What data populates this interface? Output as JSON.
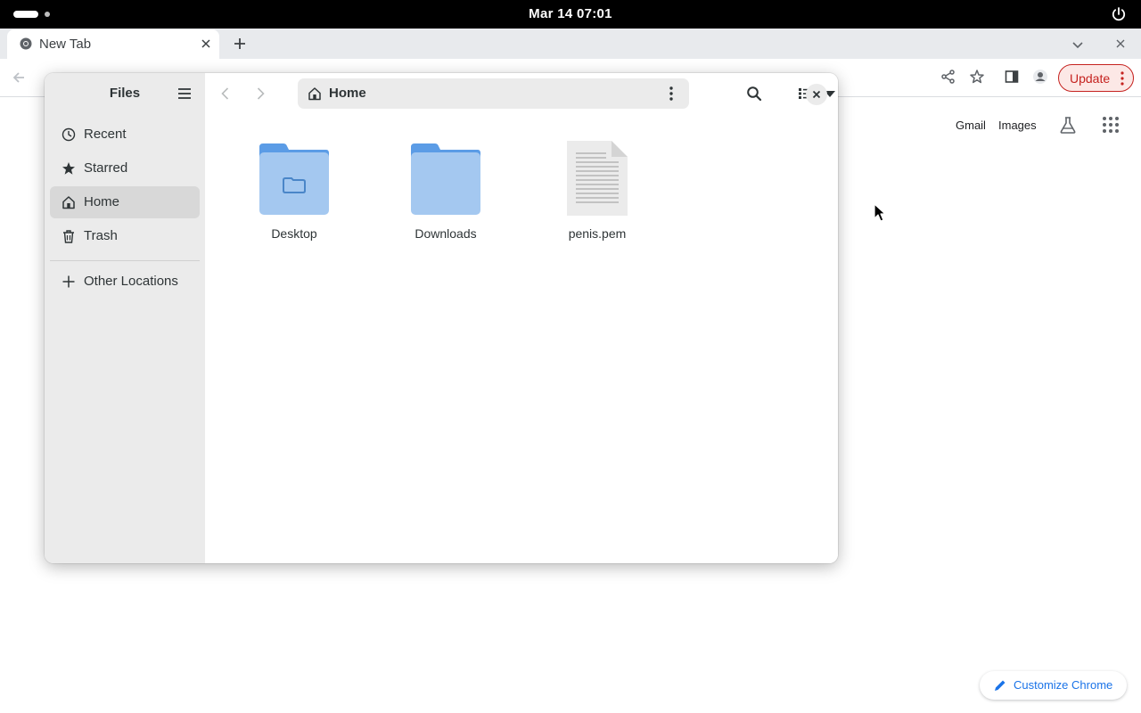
{
  "topbar": {
    "clock": "Mar 14  07:01",
    "activities_icon": "activities-pill-icon",
    "power_icon": "power-icon"
  },
  "chrome": {
    "tab": {
      "title": "New Tab",
      "favicon": "chrome-icon",
      "close_icon": "close-icon"
    },
    "new_tab_icon": "plus-icon",
    "tab_search_icon": "chevron-down-icon",
    "window_close_icon": "close-icon",
    "toolbar_icons": [
      "back-arrow-icon",
      "share-icon",
      "star-icon",
      "side-panel-icon",
      "profile-icon",
      "kebab-menu-icon"
    ],
    "update_label": "Update",
    "accent": "#c5221f"
  },
  "ntp": {
    "gmail": "Gmail",
    "images": "Images",
    "labs_icon": "flask-icon",
    "apps_icon": "apps-grid-icon",
    "customize_label": "Customize Chrome",
    "customize_icon": "pencil-icon",
    "link_color": "#1a73e8"
  },
  "files": {
    "title": "Files",
    "menu_icon": "hamburger-menu-icon",
    "sidebar": [
      {
        "label": "Recent",
        "icon": "clock-icon",
        "active": false
      },
      {
        "label": "Starred",
        "icon": "star-icon",
        "active": false
      },
      {
        "label": "Home",
        "icon": "home-icon",
        "active": true
      },
      {
        "label": "Trash",
        "icon": "trash-icon",
        "active": false
      }
    ],
    "other_locations": {
      "label": "Other Locations",
      "icon": "plus-icon"
    },
    "path": {
      "label": "Home",
      "icon": "home-icon"
    },
    "header_icons": [
      "back-icon",
      "forward-icon",
      "more-vertical-icon",
      "search-icon",
      "list-view-icon",
      "dropdown-arrow-icon",
      "close-icon"
    ],
    "items": [
      {
        "name": "Desktop",
        "type": "folder"
      },
      {
        "name": "Downloads",
        "type": "folder"
      },
      {
        "name": "penis.pem",
        "type": "file"
      }
    ],
    "folder_color": "#a4c8f0",
    "folder_tab_color": "#5b9ce6"
  }
}
